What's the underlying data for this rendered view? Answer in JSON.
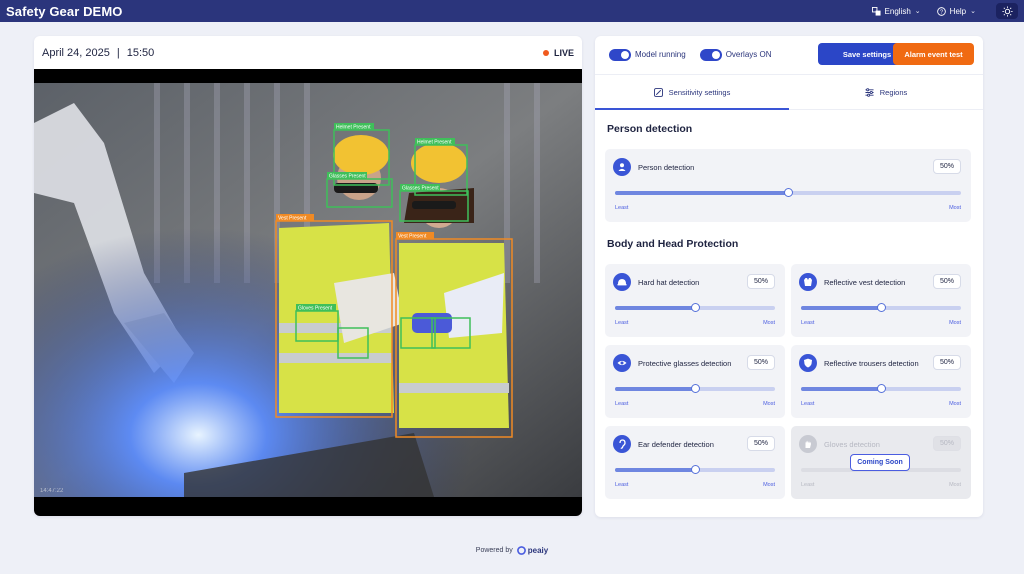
{
  "app": {
    "title": "Safety Gear DEMO"
  },
  "topbar": {
    "language": "English",
    "help": "Help"
  },
  "video": {
    "date": "April 24, 2025",
    "time": "15:50",
    "live_label": "LIVE",
    "timestamp_overlay": "14:47:22",
    "detections": {
      "helmet_1": "Helmet Present",
      "helmet_2": "Helmet Present",
      "glasses_1": "Glasses Present",
      "glasses_2": "Glasses Present",
      "vest_1": "Vest Present",
      "vest_2": "Vest Present",
      "gloves_1": "Gloves Present"
    },
    "colors": {
      "present": "#3fbf5a",
      "vest": "#f08a24"
    }
  },
  "controls": {
    "model_running": "Model running",
    "overlays": "Overlays ON",
    "save": "Save settings",
    "alarm": "Alarm event test"
  },
  "tabs": {
    "sensitivity": "Sensitivity settings",
    "regions": "Regions"
  },
  "sections": {
    "person": "Person detection",
    "body": "Body and Head Protection"
  },
  "slider_labels": {
    "min": "Least",
    "max": "Most"
  },
  "settings": {
    "person": {
      "label": "Person detection",
      "value": "50%",
      "level": 0.5
    },
    "hard_hat": {
      "label": "Hard hat detection",
      "value": "50%",
      "level": 0.5
    },
    "vest": {
      "label": "Reflective vest detection",
      "value": "50%",
      "level": 0.5
    },
    "glasses": {
      "label": "Protective glasses detection",
      "value": "50%",
      "level": 0.5
    },
    "trousers": {
      "label": "Reflective trousers detection",
      "value": "50%",
      "level": 0.5
    },
    "ear": {
      "label": "Ear defender detection",
      "value": "50%",
      "level": 0.5
    },
    "gloves": {
      "label": "Gloves detection",
      "value": "50%",
      "level": 0.5,
      "badge": "Coming Soon"
    }
  },
  "footer": {
    "powered_by": "Powered by",
    "brand": "peaiy"
  },
  "accent": "#2b46c7"
}
